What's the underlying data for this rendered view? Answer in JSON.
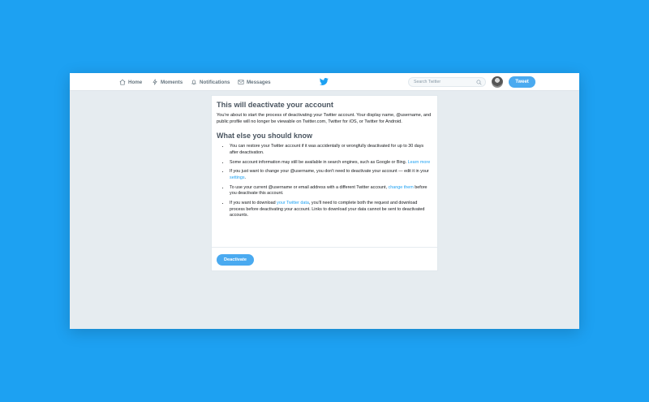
{
  "nav": {
    "home": "Home",
    "moments": "Moments",
    "notifications": "Notifications",
    "messages": "Messages",
    "search_placeholder": "Search Twitter",
    "tweet": "Tweet"
  },
  "colors": {
    "brand": "#1da1f2",
    "button": "#4aaaf0",
    "background": "#e6ecf0"
  },
  "icons": {
    "home": "home-icon",
    "moments": "lightning-icon",
    "notifications": "bell-icon",
    "messages": "envelope-icon",
    "logo": "twitter-bird-icon",
    "search": "search-icon"
  },
  "card": {
    "title": "This will deactivate your account",
    "intro": "You're about to start the process of deactivating your Twitter account. Your display name, @username, and public profile will no longer be viewable on Twitter.com, Twitter for iOS, or Twitter for Android.",
    "subtitle": "What else you should know",
    "bullets": {
      "b1": "You can restore your Twitter account if it was accidentally or wrongfully deactivated for up to 30 days after deactivation.",
      "b2_text": "Some account information may still be available in search engines, such as Google or Bing.",
      "b2_link": "Learn more",
      "b3_text": "If you just want to change your @username, you don't need to deactivate your account — edit it in your",
      "b3_link": "settings",
      "b3_end": ".",
      "b4_text": "To use your current @username or email address with a different Twitter account,",
      "b4_link": "change them",
      "b4_end": "before you deactivate this account.",
      "b5_text": "If you want to download",
      "b5_link": "your Twitter data",
      "b5_end": ", you'll need to complete both the request and download process before deactivating your account. Links to download your data cannot be sent to deactivated accounts."
    },
    "button": "Deactivate"
  }
}
